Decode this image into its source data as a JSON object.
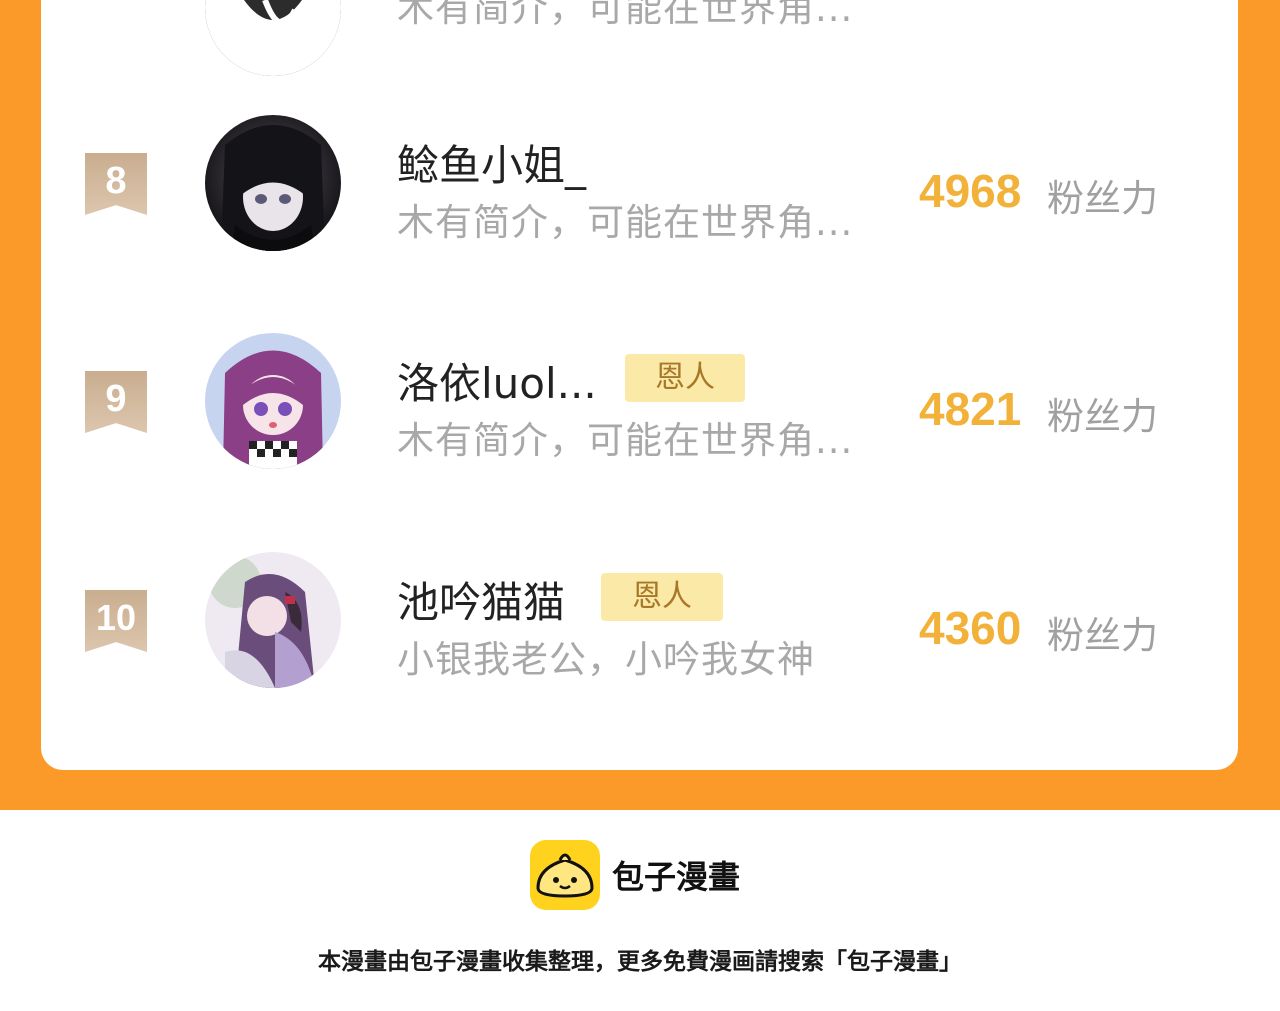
{
  "ranking": {
    "partial_top_row": {
      "bio": "木有简介，可能在世界角..."
    },
    "entries": [
      {
        "rank": "8",
        "name": "鲶鱼小姐_",
        "tag": "",
        "bio": "木有简介，可能在世界角...",
        "fans": "4968",
        "fans_label": "粉丝力",
        "avatar_icon": "avatar-dark-hair-girl"
      },
      {
        "rank": "9",
        "name": "洛依luol...",
        "tag": "恩人",
        "bio": "木有简介，可能在世界角...",
        "fans": "4821",
        "fans_label": "粉丝力",
        "avatar_icon": "avatar-purple-hair-girl"
      },
      {
        "rank": "10",
        "name": "池吟猫猫",
        "tag": "恩人",
        "bio": "小银我老公，小吟我女神",
        "fans": "4360",
        "fans_label": "粉丝力",
        "avatar_icon": "avatar-couple-illustration"
      }
    ]
  },
  "footer": {
    "brand": "包子漫畫",
    "note": "本漫畫由包子漫畫收集整理，更多免費漫画請搜索「包子漫畫」"
  },
  "colors": {
    "background": "#fb9a28",
    "fans_number": "#f2b23a",
    "tag_bg": "#fbeaa7",
    "rank_badge": "#c9ad8f",
    "logo": "#ffd21d"
  }
}
